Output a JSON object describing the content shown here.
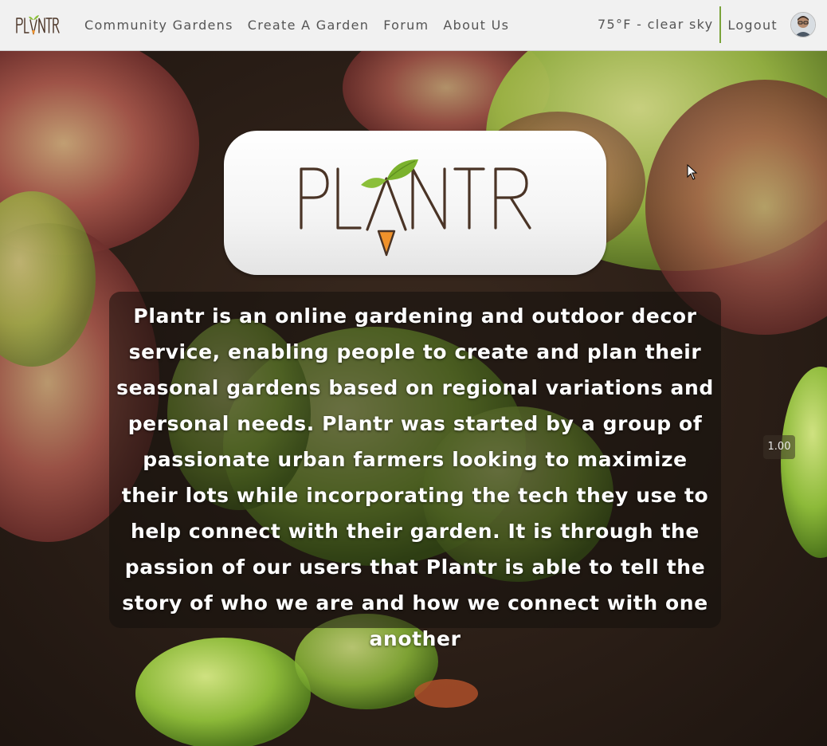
{
  "app": {
    "brand": "PLANTR"
  },
  "nav": {
    "links": [
      {
        "label": "Community Gardens"
      },
      {
        "label": "Create A Garden"
      },
      {
        "label": "Forum"
      },
      {
        "label": "About Us"
      }
    ],
    "weather": "75°F - clear sky",
    "logout_label": "Logout",
    "avatar_icon": "user-avatar"
  },
  "hero": {
    "logo_text": "PLANTR",
    "about": "Plantr is an online gardening and outdoor decor service, enabling people to create and plan their seasonal gardens based on regional variations and personal needs. Plantr was started by a group of passionate urban farmers looking to maximize their lots while incorporating the tech they use to help connect with their garden. It is through the passion of our users that Plantr is able to tell the story of who we are and how we connect with one another"
  },
  "video": {
    "playback_speed": "1.00"
  },
  "colors": {
    "accent_green": "#7aa33a",
    "logo_brown": "#4a3426",
    "logo_orange": "#f0922b",
    "nav_bg": "#f1f1f1",
    "nav_text": "#555555"
  }
}
